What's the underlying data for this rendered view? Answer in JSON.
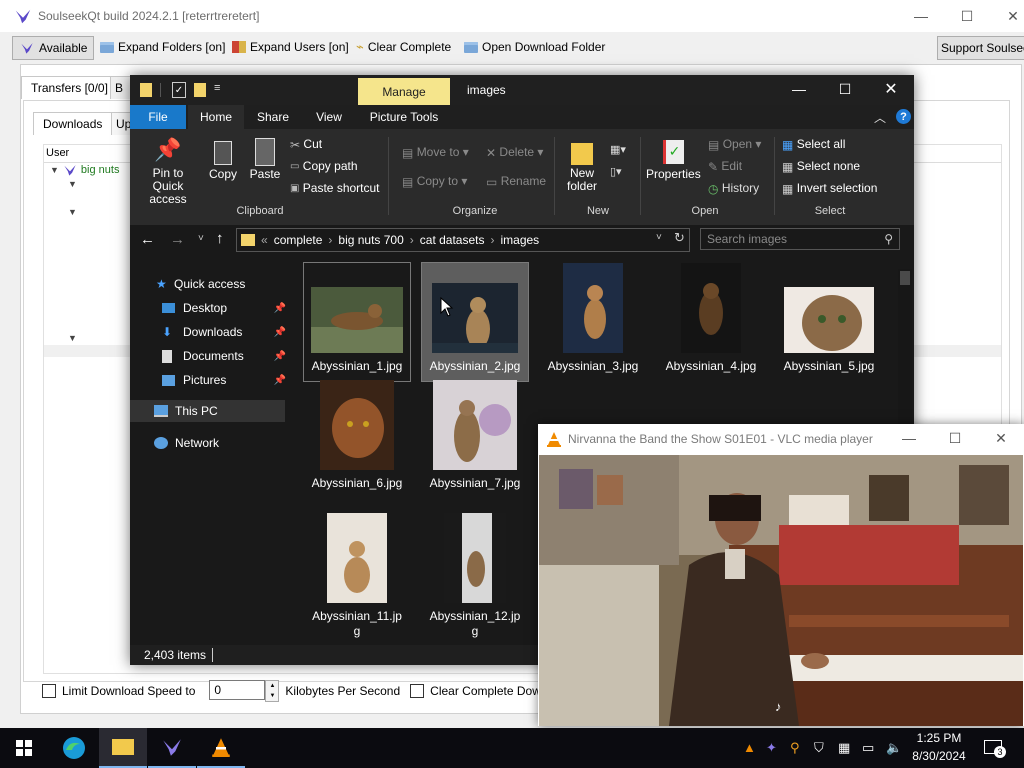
{
  "soulseek": {
    "title": "SoulseekQt build 2024.2.1 [reterrtreretert]",
    "toolbar": {
      "available": "Available",
      "expand_folders": "Expand Folders [on]",
      "expand_users": "Expand Users [on]",
      "clear_complete": "Clear Complete",
      "open_download_folder": "Open Download Folder",
      "support": "Support Soulseek"
    },
    "main_tab": "Transfers [0/0]",
    "subtabs": {
      "downloads": "Downloads",
      "uploads": "Up"
    },
    "column_user": "User",
    "user_row": "big nuts",
    "bottom": {
      "limit_speed": "Limit Download Speed to",
      "speed_value": "0",
      "unit": "Kilobytes Per Second",
      "clear_complete": "Clear Complete Downloads"
    }
  },
  "explorer": {
    "title": "images",
    "manage": "Manage",
    "tabs": [
      "File",
      "Home",
      "Share",
      "View",
      "Picture Tools"
    ],
    "ribbon": {
      "pin": "Pin to Quick access",
      "copy": "Copy",
      "paste": "Paste",
      "cut": "Cut",
      "copy_path": "Copy path",
      "paste_shortcut": "Paste shortcut",
      "move_to": "Move to",
      "copy_to": "Copy to",
      "delete": "Delete",
      "rename": "Rename",
      "new_folder": "New folder",
      "properties": "Properties",
      "open": "Open",
      "edit": "Edit",
      "history": "History",
      "select_all": "Select all",
      "select_none": "Select none",
      "invert_selection": "Invert selection",
      "groups": [
        "Clipboard",
        "Organize",
        "New",
        "Open",
        "Select"
      ]
    },
    "breadcrumb": [
      "complete",
      "big nuts 700",
      "cat datasets",
      "images"
    ],
    "search_placeholder": "Search images",
    "nav": {
      "quick_access": "Quick access",
      "desktop": "Desktop",
      "downloads": "Downloads",
      "documents": "Documents",
      "pictures": "Pictures",
      "this_pc": "This PC",
      "network": "Network"
    },
    "files": [
      "Abyssinian_1.jpg",
      "Abyssinian_2.jpg",
      "Abyssinian_3.jpg",
      "Abyssinian_4.jpg",
      "Abyssinian_5.jpg",
      "Abyssinian_6.jpg",
      "Abyssinian_7.jpg",
      "Abyssinian_11.jpg",
      "Abyssinian_12.jpg"
    ],
    "status": "2,403 items"
  },
  "vlc": {
    "title": "Nirvanna the Band the Show S01E01 - VLC media player"
  },
  "taskbar": {
    "time": "1:25 PM",
    "date": "8/30/2024",
    "notification_count": "3"
  },
  "colors": {
    "explorer_bg": "#191919",
    "manage_tab": "#f5e58c",
    "file_tab": "#1979ca",
    "taskbar": "#0b0b10"
  }
}
